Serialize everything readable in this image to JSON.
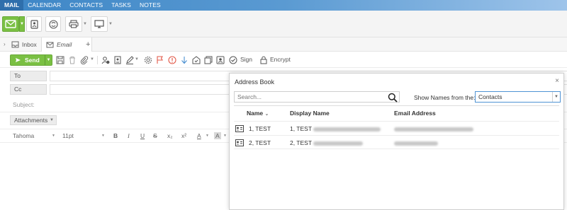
{
  "nav": {
    "items": [
      "MAIL",
      "CALENDAR",
      "CONTACTS",
      "TASKS",
      "NOTES"
    ],
    "active_index": 0
  },
  "tabs": {
    "inbox": "Inbox",
    "email": "Email",
    "add": "+"
  },
  "compose": {
    "send_label": "Send",
    "sign_label": "Sign",
    "encrypt_label": "Encrypt",
    "to_label": "To",
    "cc_label": "Cc",
    "subject_placeholder": "Subject:",
    "attachments_label": "Attachments"
  },
  "format": {
    "font": "Tahoma",
    "size": "11pt",
    "bold": "B",
    "italic": "I",
    "underline": "U",
    "strike": "S",
    "subscript": "x₂",
    "superscript": "x²",
    "font_color": "A",
    "highlight": "A"
  },
  "address_book": {
    "title": "Address Book",
    "close": "×",
    "search_placeholder": "Search...",
    "show_names_label": "Show Names from the:",
    "source_selected": "Contacts",
    "columns": [
      "Name",
      "Display Name",
      "Email Address"
    ],
    "rows": [
      {
        "name": "1, TEST",
        "display": "1, TEST"
      },
      {
        "name": "2, TEST",
        "display": "2, TEST"
      }
    ]
  },
  "colors": {
    "accent_green": "#7ac043",
    "nav_blue": "#3d86c6",
    "select_border": "#4f93d4"
  }
}
